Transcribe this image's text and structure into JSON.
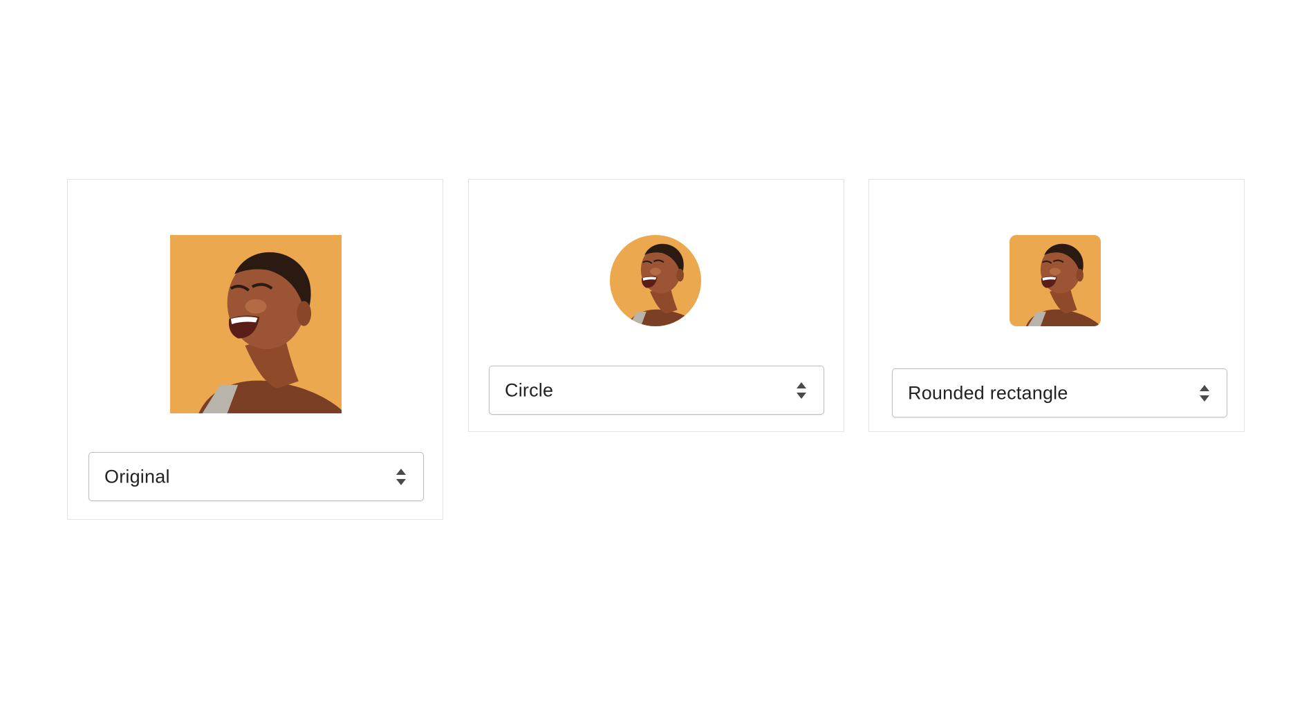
{
  "cards": [
    {
      "shape_label": "Original",
      "image_alt": "photo of laughing woman"
    },
    {
      "shape_label": "Circle",
      "image_alt": "photo of laughing woman"
    },
    {
      "shape_label": "Rounded rectangle",
      "image_alt": "photo of laughing woman"
    }
  ],
  "icons": {
    "select_arrows": "up-down-chevron-icon"
  },
  "colors": {
    "photo_background": "#e8a449",
    "card_border": "#e3e3e3",
    "select_border": "#bdbdbd",
    "text": "#222222",
    "arrow": "#4a4a4a"
  }
}
